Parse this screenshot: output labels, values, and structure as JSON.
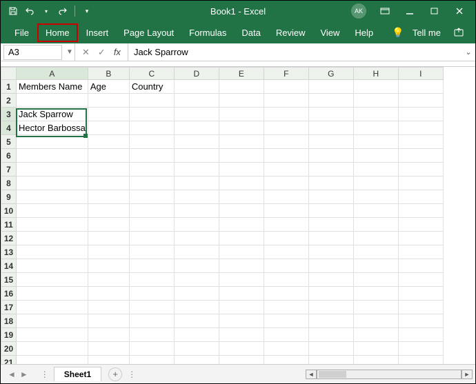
{
  "titlebar": {
    "title": "Book1  -  Excel",
    "avatar": "AK"
  },
  "ribbon": {
    "file": "File",
    "home": "Home",
    "insert": "Insert",
    "page_layout": "Page Layout",
    "formulas": "Formulas",
    "data": "Data",
    "review": "Review",
    "view": "View",
    "help": "Help",
    "tellme": "Tell me"
  },
  "formula_bar": {
    "name_box": "A3",
    "fx": "fx",
    "value": "Jack Sparrow"
  },
  "columns": [
    "A",
    "B",
    "C",
    "D",
    "E",
    "F",
    "G",
    "H",
    "I"
  ],
  "rows_count": 21,
  "cells": {
    "A1": "Members Name",
    "B1": "Age",
    "C1": "Country",
    "A3": "Jack Sparrow",
    "A4": "Hector Barbossa"
  },
  "selection": {
    "top_row": 3,
    "bottom_row": 4,
    "col": "A"
  },
  "sheet": {
    "name": "Sheet1"
  }
}
